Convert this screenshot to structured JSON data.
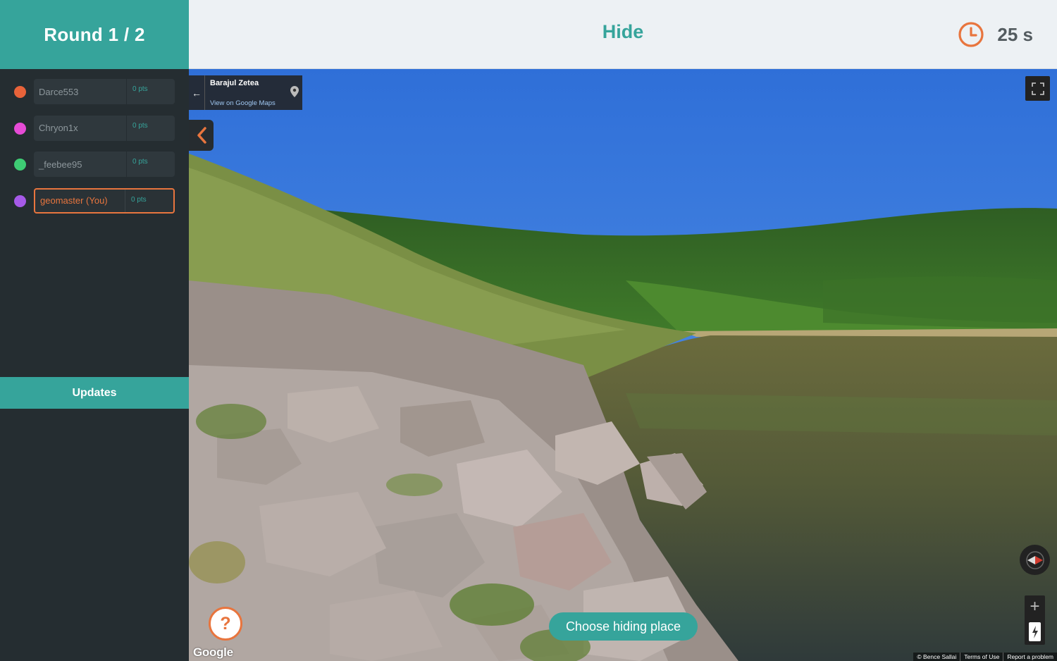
{
  "round": {
    "label": "Round 1 / 2"
  },
  "players": [
    {
      "name": "Darce553",
      "points": "0 pts",
      "color": "#e8633a"
    },
    {
      "name": "Chryon1x",
      "points": "0 pts",
      "color": "#e64bd6"
    },
    {
      "name": "_feebee95",
      "points": "0 pts",
      "color": "#3ecc74"
    },
    {
      "name": "geomaster (You)",
      "points": "0 pts",
      "color": "#a65ae8"
    }
  ],
  "sidebar": {
    "updates_label": "Updates"
  },
  "header": {
    "phase": "Hide",
    "timer": "25 s"
  },
  "streetview": {
    "location_title": "Barajul Zetea",
    "location_link": "View on Google Maps",
    "google_logo": "Google",
    "attribution": [
      "© Bence Sallai",
      "Terms of Use",
      "Report a problem"
    ]
  },
  "actions": {
    "help_label": "?",
    "choose_label": "Choose hiding place"
  },
  "colors": {
    "accent": "#36a49b",
    "warning": "#e8753e",
    "sidebar_bg": "#252d31"
  }
}
